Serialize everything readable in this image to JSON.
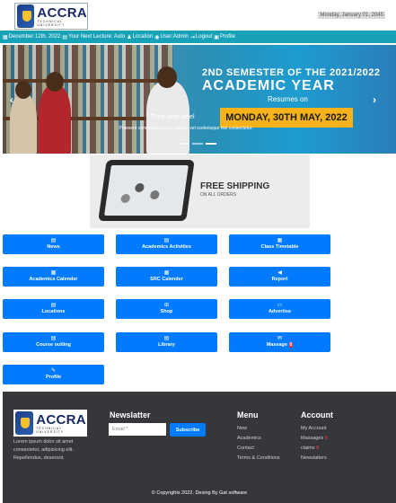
{
  "header": {
    "logo_text": "ACCRA",
    "logo_subtitle": "TECHNICAL UNIVERSITY",
    "date": "Monday, January 01, 2045"
  },
  "infobar": {
    "date_label": "December 12th, 2022",
    "lecture": "Your Next Lecture: Auto",
    "location": "Location",
    "user": "User:Admin",
    "logout": "Logout",
    "profile": "Profile"
  },
  "slider": {
    "semester_line": "2ND SEMESTER OF THE 2021/2022",
    "headline": "ACADEMIC YEAR",
    "resumes": "Resumes on",
    "resume_date": "MONDAY, 30TH MAY, 2022",
    "caption_title": "Third slide label",
    "caption_text": "Praesent commodo cursus magna, vel scelerisque nisl consectetur.",
    "prev_arrow": "‹",
    "next_arrow": "›"
  },
  "ad": {
    "title": "FREE SHIPPING",
    "subtitle": "ON ALL ORDERS"
  },
  "tiles": [
    {
      "label": "News",
      "icon": "newspaper-icon",
      "glyph": "▤"
    },
    {
      "label": "Academics Activities",
      "icon": "list-icon",
      "glyph": "▤"
    },
    {
      "label": "Class Timetable",
      "icon": "calendar-icon",
      "glyph": "▦"
    },
    {
      "label": "Academics Calender",
      "icon": "calendar-icon",
      "glyph": "▦"
    },
    {
      "label": "SRC Calender",
      "icon": "calendar-icon",
      "glyph": "▦"
    },
    {
      "label": "Report",
      "icon": "send-icon",
      "glyph": "◀"
    },
    {
      "label": "Locations",
      "icon": "map-icon",
      "glyph": "▤"
    },
    {
      "label": "Shop",
      "icon": "cart-icon",
      "glyph": "⊞"
    },
    {
      "label": "Advertise",
      "icon": "display-icon",
      "glyph": "▭"
    },
    {
      "label": "Course outling",
      "icon": "book-icon",
      "glyph": "▤"
    },
    {
      "label": "Library",
      "icon": "book-icon",
      "glyph": "▤"
    },
    {
      "label": "Massage",
      "icon": "envelope-icon",
      "glyph": "✉",
      "badge": "0"
    },
    {
      "label": "Profile",
      "icon": "edit-icon",
      "glyph": "✎"
    }
  ],
  "footer": {
    "logo_text": "ACCRA",
    "logo_subtitle": "TECHNICAL UNIVERSITY",
    "about": "Lorem ipsum dolor sit amet consectetur, adipisicing elit. Repellendus, deserunt.",
    "newsletter_title": "Newslatter",
    "email_placeholder": "Email *",
    "subscribe_label": "Subscribe",
    "menu_title": "Menu",
    "menu_items": [
      "New",
      "Academics",
      "Contact",
      "Terms & Conditions"
    ],
    "account_title": "Account",
    "account_items": [
      "My Account",
      "Massages",
      "claims",
      "Newslatters"
    ],
    "massages_count": "0",
    "claims_count": "0",
    "copyright": "© Copyrights 2022. Desing By Gat software"
  },
  "colors": {
    "primary": "#007bff",
    "infobar": "#17a2b8",
    "footer": "#35373a",
    "badge": "#dc3545",
    "accent_yellow": "#f5b21b"
  }
}
